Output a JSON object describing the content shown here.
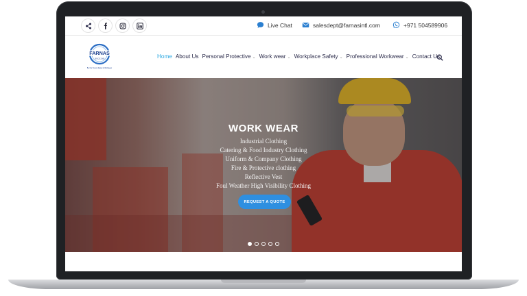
{
  "topbar": {
    "social": [
      {
        "icon": "share-icon"
      },
      {
        "icon": "facebook-icon"
      },
      {
        "icon": "instagram-icon"
      },
      {
        "icon": "linkedin-icon"
      }
    ],
    "live_chat": "Live Chat",
    "email": "salesdept@farnasintl.com",
    "phone": "+971 504589906"
  },
  "logo": {
    "name": "FARNAS",
    "since": "SINCE 2008",
    "tagline": "Be Our Future Safety & Workwear"
  },
  "nav": {
    "items": [
      {
        "label": "Home",
        "dropdown": false
      },
      {
        "label": "About Us",
        "dropdown": false
      },
      {
        "label": "Personal Protective",
        "dropdown": true
      },
      {
        "label": "Work wear",
        "dropdown": true
      },
      {
        "label": "Workplace Safety",
        "dropdown": true
      },
      {
        "label": "Professional Workwear",
        "dropdown": true
      },
      {
        "label": "Contact Us",
        "dropdown": false
      }
    ],
    "active_index": 0
  },
  "hero": {
    "title": "WORK WEAR",
    "lines": [
      "Industrial Clothing",
      "Catering & Food Industry Clothing",
      "Uniform & Company Clothing",
      "Fire & Protective clothing",
      "Reflective Vest",
      "Foul Weather High Visibility Clothing"
    ],
    "cta": "REQUEST A QUOTE",
    "slides": 5,
    "active_slide": 0
  },
  "colors": {
    "accent": "#2aa7e0",
    "cta": "#2e8fe0",
    "nav_text": "#2b2b4a"
  }
}
